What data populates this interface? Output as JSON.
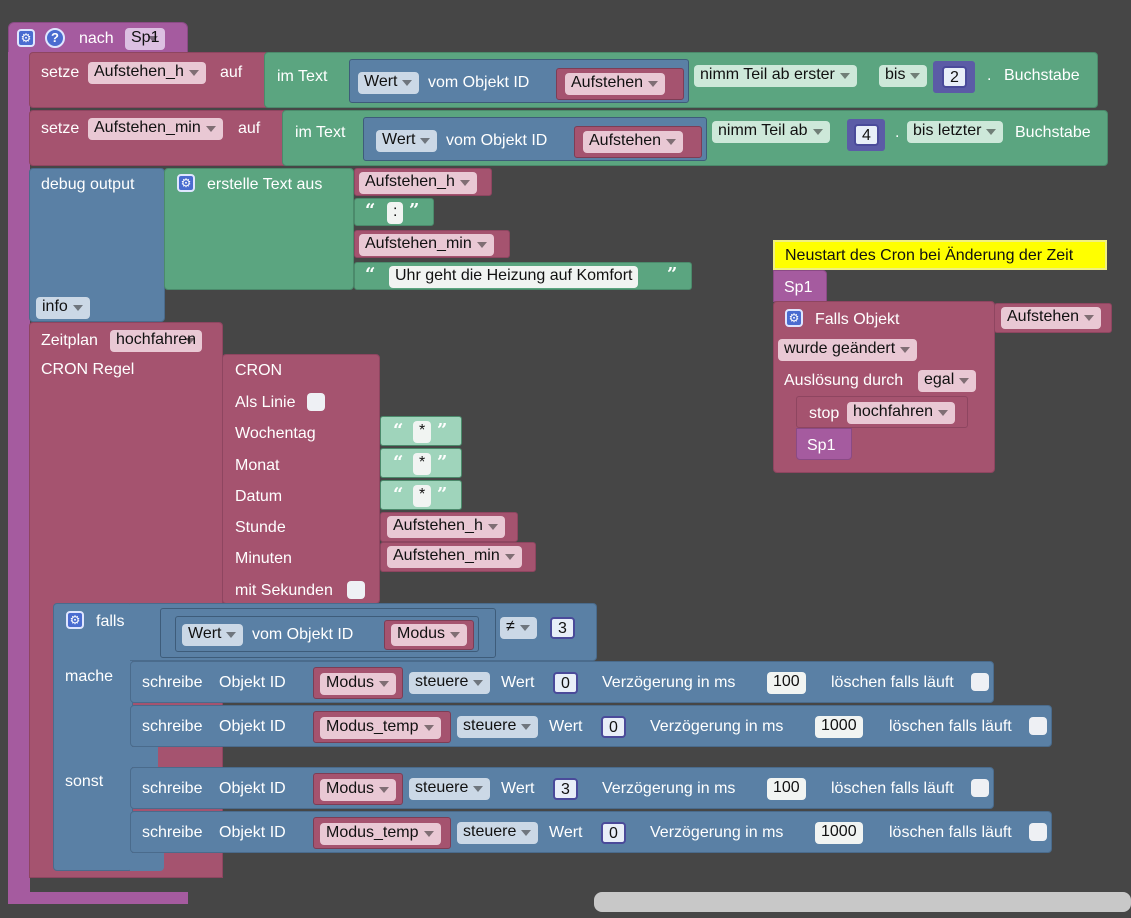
{
  "root": {
    "help_glyph": "?",
    "label": "nach",
    "value": "Sp1"
  },
  "set1": {
    "label": "setze",
    "var": "Aufstehen_h",
    "auf": "auf",
    "imtext": "im Text",
    "wert": "Wert",
    "vomobj": "vom Objekt ID",
    "obj": "Aufstehen",
    "take": "nimm Teil ab erster",
    "bis": "bis",
    "num": "2",
    "dot": ".",
    "suffix": "Buchstabe"
  },
  "set2": {
    "label": "setze",
    "var": "Aufstehen_min",
    "auf": "auf",
    "imtext": "im Text",
    "wert": "Wert",
    "vomobj": "vom Objekt ID",
    "obj": "Aufstehen",
    "take": "nimm Teil ab",
    "num": "4",
    "dot": ".",
    "bis": "bis letzter",
    "suffix": "Buchstabe"
  },
  "debug": {
    "label": "debug output",
    "create": "erstelle Text aus",
    "item1": "Aufstehen_h",
    "item2": ":",
    "item3": "Aufstehen_min",
    "item4": "Uhr geht die Heizung auf Komfort",
    "level": "info"
  },
  "schedule": {
    "label": "Zeitplan",
    "name": "hochfahren",
    "cron_rule": "CRON Regel",
    "cron": "CRON",
    "als_linie": "Als Linie",
    "wochentag": "Wochentag",
    "monat": "Monat",
    "datum": "Datum",
    "stunde": "Stunde",
    "minuten": "Minuten",
    "mit_sekunden": "mit Sekunden",
    "star": "*",
    "stunde_var": "Aufstehen_h",
    "minuten_var": "Aufstehen_min"
  },
  "ifblock": {
    "falls": "falls",
    "wert": "Wert",
    "vomobj": "vom Objekt ID",
    "obj": "Modus",
    "op": "≠",
    "num": "3",
    "mache": "mache",
    "sonst": "sonst",
    "rows": [
      {
        "schreibe": "schreibe",
        "objid": "Objekt ID",
        "obj": "Modus",
        "mode": "steuere",
        "wert": "Wert",
        "val": "0",
        "delay_label": "Verzögerung in ms",
        "delay": "100",
        "clear": "löschen falls läuft"
      },
      {
        "schreibe": "schreibe",
        "objid": "Objekt ID",
        "obj": "Modus_temp",
        "mode": "steuere",
        "wert": "Wert",
        "val": "0",
        "delay_label": "Verzögerung in ms",
        "delay": "1000",
        "clear": "löschen falls läuft"
      },
      {
        "schreibe": "schreibe",
        "objid": "Objekt ID",
        "obj": "Modus",
        "mode": "steuere",
        "wert": "Wert",
        "val": "3",
        "delay_label": "Verzögerung in ms",
        "delay": "100",
        "clear": "löschen falls läuft"
      },
      {
        "schreibe": "schreibe",
        "objid": "Objekt ID",
        "obj": "Modus_temp",
        "mode": "steuere",
        "wert": "Wert",
        "val": "0",
        "delay_label": "Verzögerung in ms",
        "delay": "1000",
        "clear": "löschen falls läuft"
      }
    ]
  },
  "trigger": {
    "comment": "Neustart des Cron bei Änderung der Zeit",
    "tag": "Sp1",
    "falls_objekt": "Falls Objekt",
    "obj": "Aufstehen",
    "changed": "wurde geändert",
    "ausloesung": "Auslösung durch",
    "egal": "egal",
    "stop": "stop",
    "stop_target": "hochfahren",
    "inner_tag": "Sp1"
  }
}
